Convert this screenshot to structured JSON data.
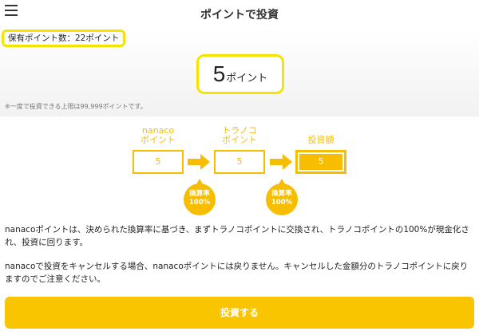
{
  "header": {
    "title": "ポイントで投資"
  },
  "owned_points": {
    "text": "保有ポイント数：22ポイント"
  },
  "point_input": {
    "value": "5",
    "unit": "ポイント"
  },
  "limit_note": "※一度で投資できる上限は99,999ポイントです。",
  "flow": {
    "step1": {
      "label_line1": "nanaco",
      "label_line2": "ポイント",
      "value": "5"
    },
    "step2": {
      "label_line1": "トラノコ",
      "label_line2": "ポイント",
      "value": "5"
    },
    "step3": {
      "label_line1": "投資額",
      "value": "5"
    },
    "rate1": {
      "line1": "換算率",
      "line2": "100%"
    },
    "rate2": {
      "line1": "換算率",
      "line2": "100%"
    }
  },
  "description": {
    "p1": "nanacoポイントは、決められた換算率に基づき、まずトラノコポイントに交換され、トラノコポイントの100%が現金化され、投資に回ります。",
    "p2": "nanacoで投資をキャンセルする場合、nanacoポイントには戻りません。キャンセルした金額分のトラノコポイントに戻りますのでご注意ください。"
  },
  "action": {
    "invest_label": "投資する"
  },
  "colors": {
    "accent": "#f7bd00",
    "highlight": "#f5e300",
    "button": "#f9c500"
  },
  "icons": {
    "menu": "menu-icon",
    "arrow": "arrow-right-icon"
  }
}
